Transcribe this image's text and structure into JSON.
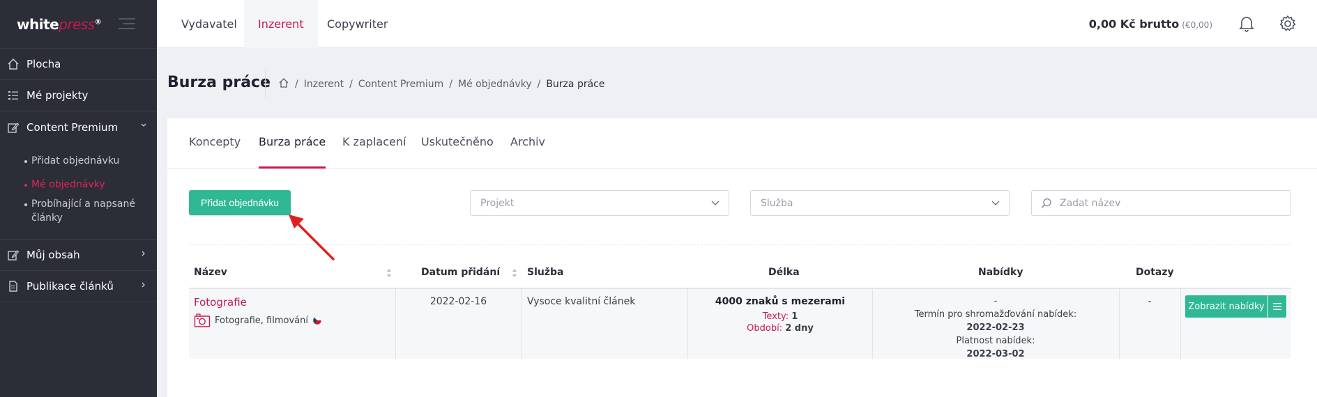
{
  "brand": {
    "logo_white": "white",
    "logo_press": "press",
    "logo_reg": "®"
  },
  "sidebar": {
    "items": [
      {
        "label": "Plocha",
        "icon": "home-icon"
      },
      {
        "label": "Mé projekty",
        "icon": "list-icon"
      },
      {
        "label": "Content Premium",
        "icon": "edit-icon",
        "expanded": true
      },
      {
        "label": "Můj obsah",
        "icon": "edit-icon"
      },
      {
        "label": "Publikace článků",
        "icon": "document-icon"
      }
    ],
    "subitems": [
      {
        "label": "Přidat objednávku"
      },
      {
        "label": "Mé objednávky",
        "active": true
      },
      {
        "label": "Probíhající a napsané články"
      }
    ]
  },
  "topbar": {
    "tabs": [
      {
        "label": "Vydavatel"
      },
      {
        "label": "Inzerent",
        "active": true
      },
      {
        "label": "Copywriter"
      }
    ],
    "balance": "0,00 Kč brutto",
    "balance_eur": "(€0,00)"
  },
  "page": {
    "title": "Burza práce",
    "breadcrumb": [
      "Inzerent",
      "Content Premium",
      "Mé objednávky",
      "Burza práce"
    ]
  },
  "tabs": [
    {
      "label": "Koncepty"
    },
    {
      "label": "Burza práce",
      "active": true
    },
    {
      "label": "K zaplacení"
    },
    {
      "label": "Uskutečněno"
    },
    {
      "label": "Archiv"
    }
  ],
  "toolbar": {
    "add_button": "Přidat objednávku",
    "project_placeholder": "Projekt",
    "service_placeholder": "Služba",
    "search_placeholder": "Zadat název"
  },
  "table": {
    "headers": {
      "name": "Název",
      "date": "Datum přidání",
      "service": "Služba",
      "length": "Délka",
      "offers": "Nabídky",
      "questions": "Dotazy"
    },
    "rows": [
      {
        "name": "Fotografie",
        "category": "Fotografie, filmování",
        "date": "2022-02-16",
        "service": "Vysoce kvalitní článek",
        "length_main": "4000 znaků s mezerami",
        "texts_label": "Texty:",
        "texts_value": "1",
        "period_label": "Období:",
        "period_value": "2 dny",
        "offers_count": "-",
        "deadline_label": "Termín pro shromažďování nabídek:",
        "deadline_value": "2022-02-23",
        "validity_label": "Platnost nabídek:",
        "validity_value": "2022-03-02",
        "questions": "-",
        "show_button": "Zobrazit nabídky"
      }
    ]
  },
  "colors": {
    "accent": "#c7194f",
    "primary_button": "#2fb893",
    "sidebar_bg": "#2b2d37"
  }
}
